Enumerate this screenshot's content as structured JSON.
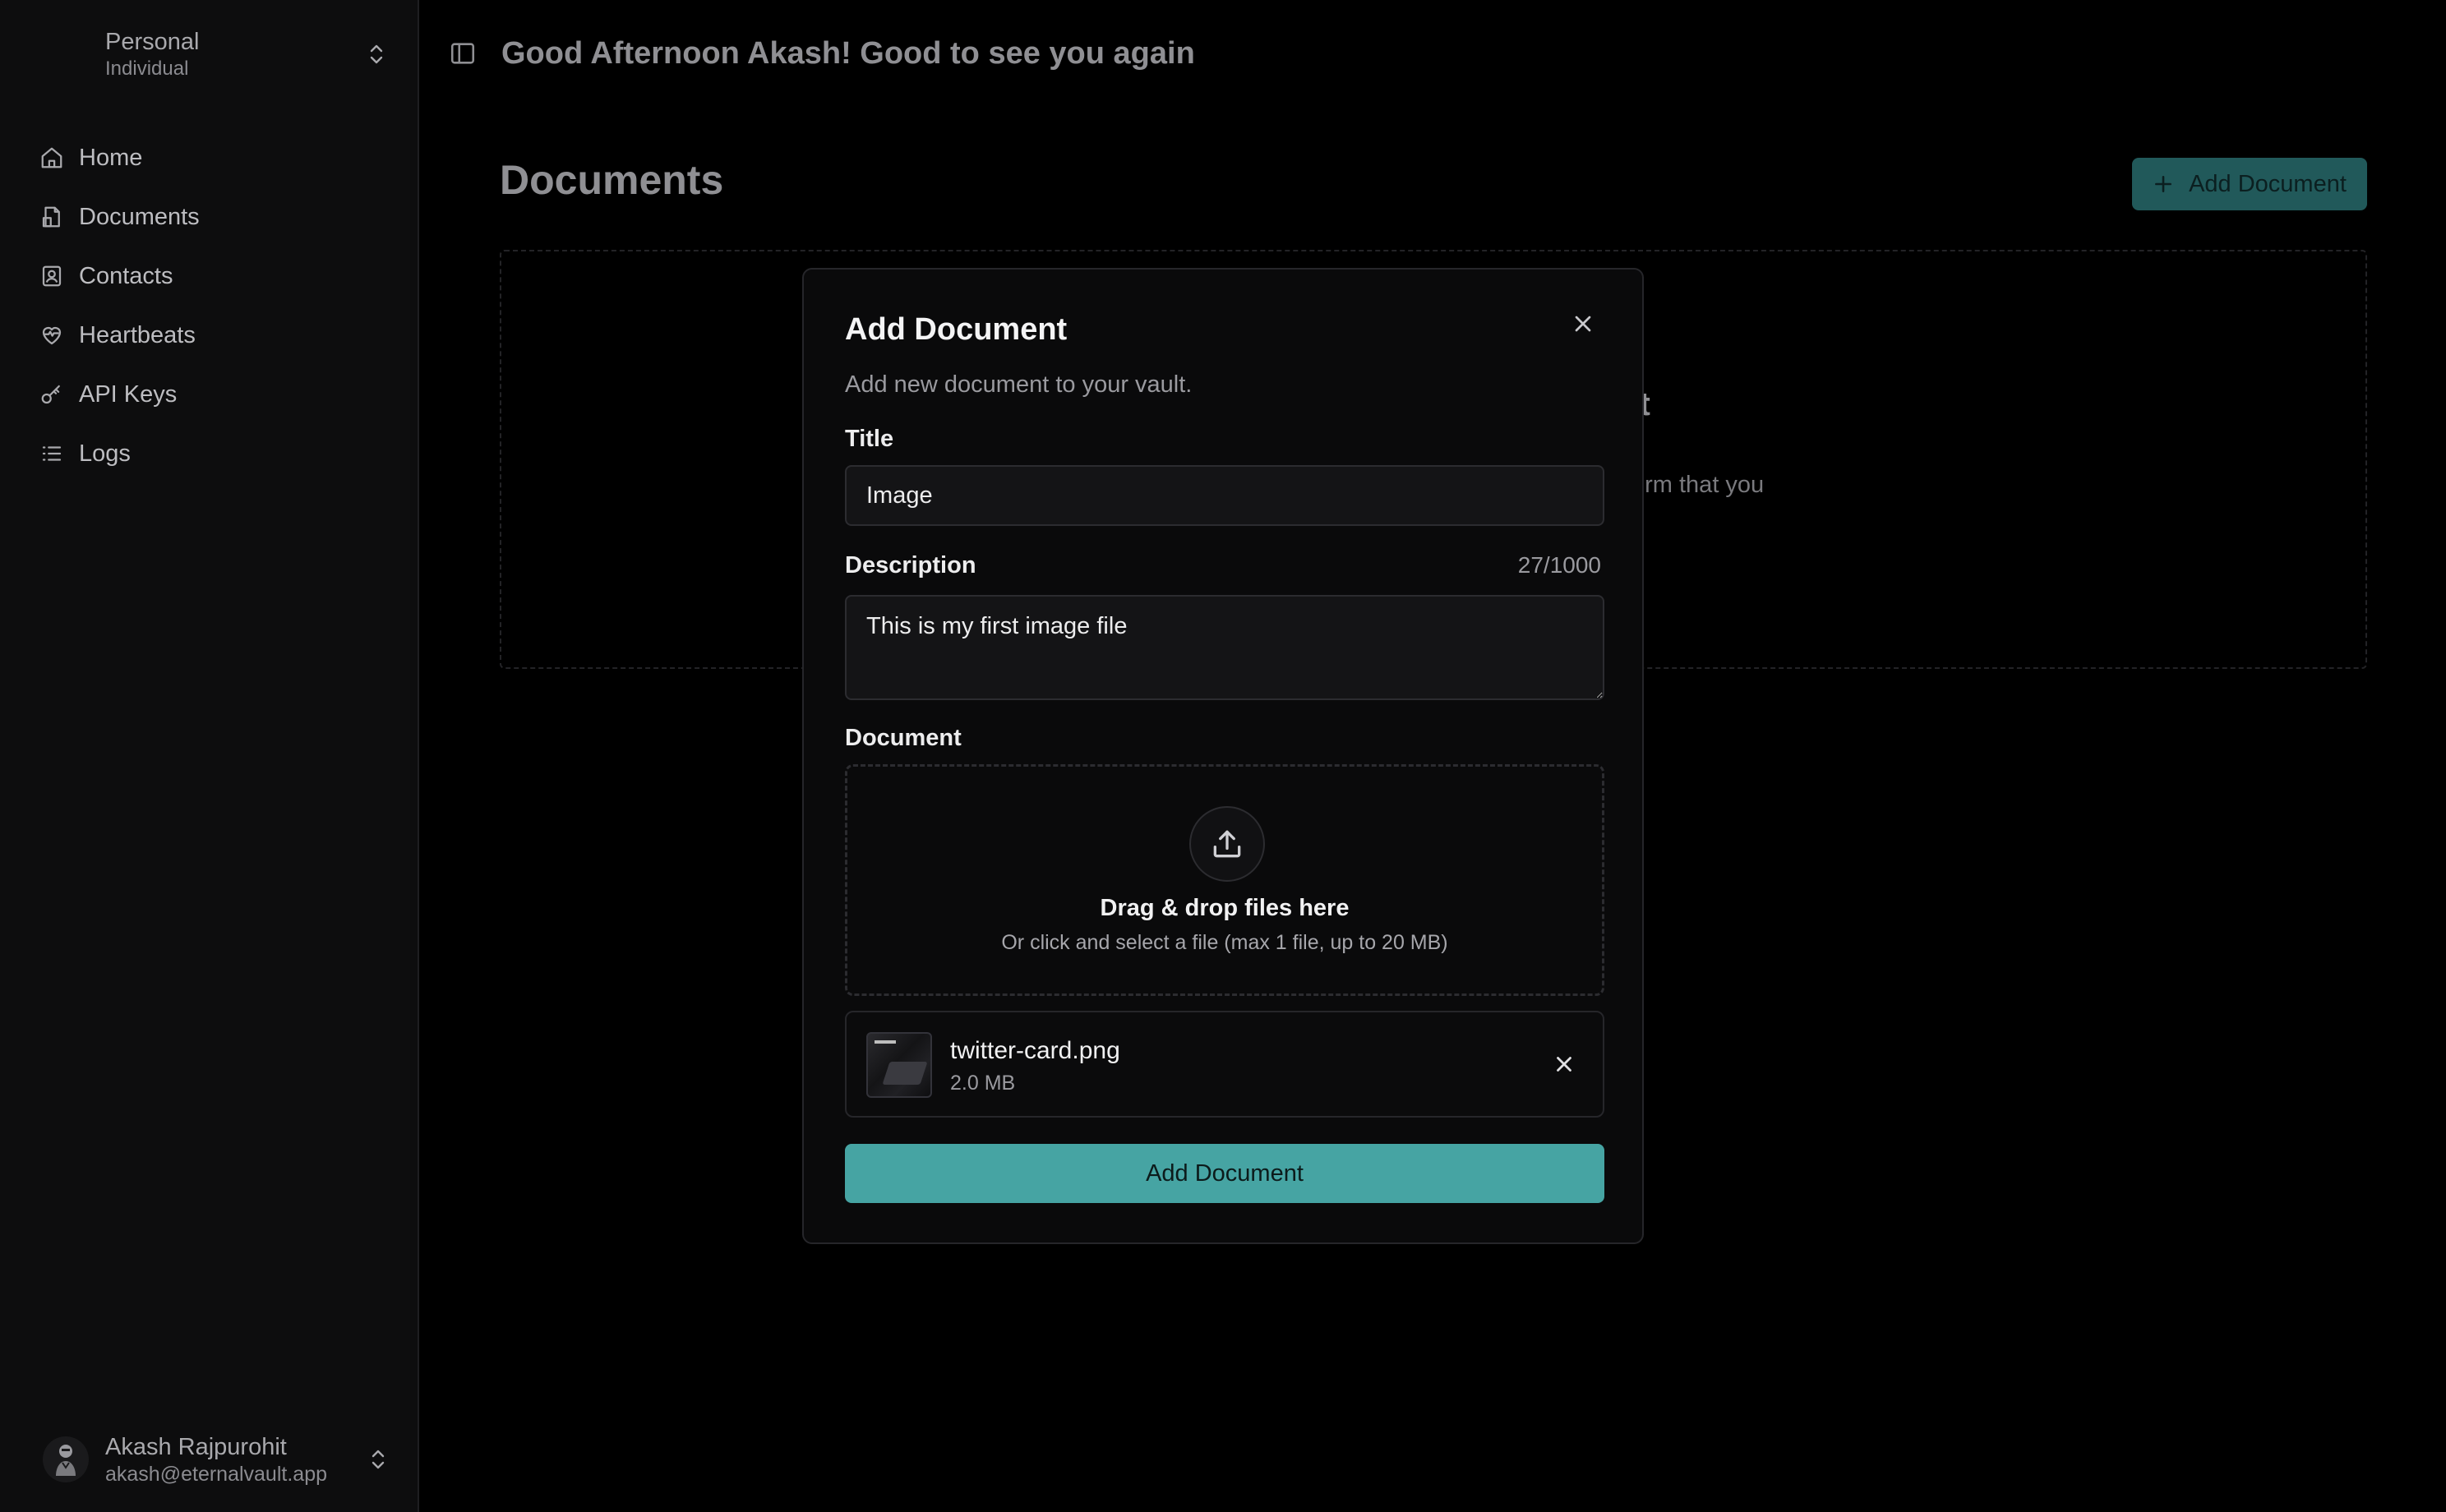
{
  "workspace": {
    "name": "Personal",
    "type": "Individual"
  },
  "nav": {
    "items": [
      {
        "label": "Home",
        "icon": "home-icon"
      },
      {
        "label": "Documents",
        "icon": "document-icon"
      },
      {
        "label": "Contacts",
        "icon": "contacts-icon"
      },
      {
        "label": "Heartbeats",
        "icon": "heartbeat-icon"
      },
      {
        "label": "API Keys",
        "icon": "key-icon"
      },
      {
        "label": "Logs",
        "icon": "list-icon"
      }
    ]
  },
  "user": {
    "name": "Akash Rajpurohit",
    "email": "akash@eternalvault.app"
  },
  "header": {
    "greeting": "Good Afternoon Akash! Good to see you again"
  },
  "page": {
    "title": "Documents",
    "add_button": "Add Document"
  },
  "empty_state": {
    "heading_fragment": "yet",
    "sub_fragment": "orm that you"
  },
  "modal": {
    "title": "Add Document",
    "subtitle": "Add new document to your vault.",
    "title_label": "Title",
    "title_value": "Image",
    "description_label": "Description",
    "description_value": "This is my first image file",
    "description_counter": "27/1000",
    "document_label": "Document",
    "dropzone": {
      "heading": "Drag & drop files here",
      "subtext": "Or click and select a file (max 1 file, up to 20 MB)"
    },
    "file": {
      "name": "twitter-card.png",
      "size": "2.0 MB"
    },
    "submit_label": "Add Document"
  },
  "colors": {
    "background": "#000000",
    "sidebar": "#0d0d0e",
    "accent": "#46a4a3",
    "accent_dim": "#21595a"
  }
}
